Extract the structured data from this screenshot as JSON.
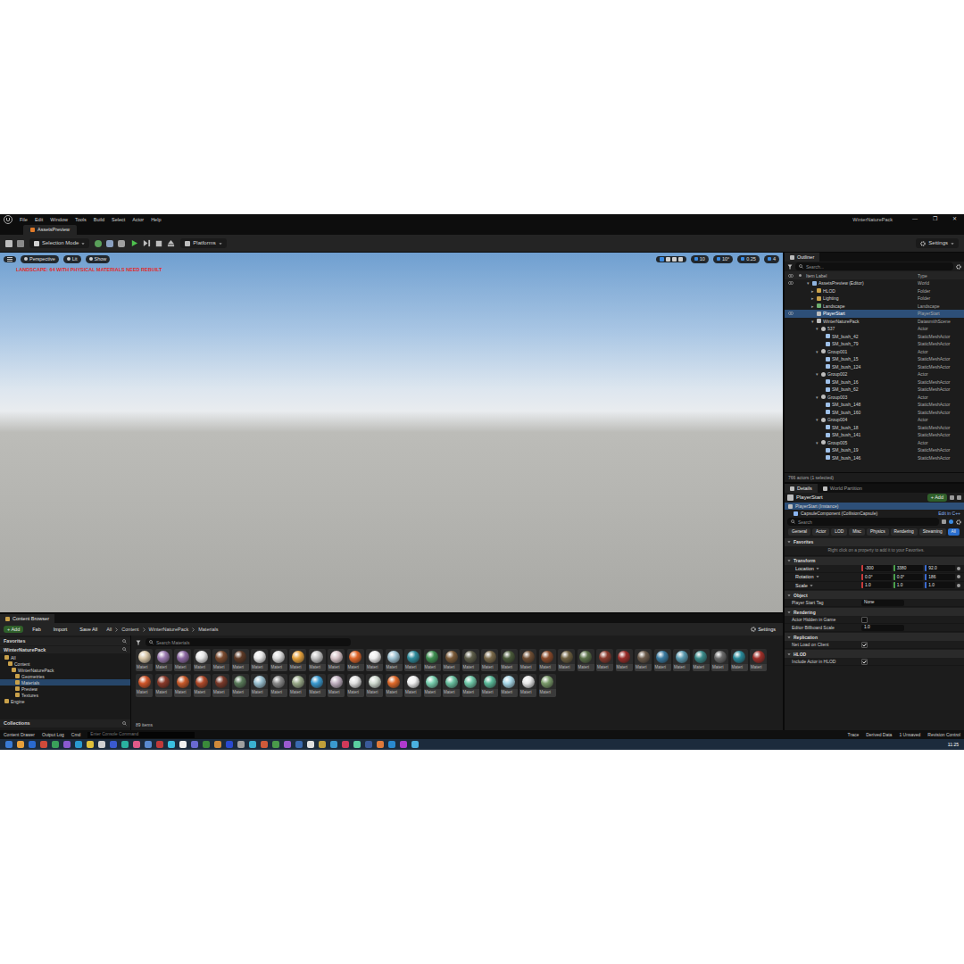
{
  "window": {
    "title": "WinterNaturePack",
    "controls": [
      "—",
      "❐",
      "✕"
    ]
  },
  "menu": [
    "File",
    "Edit",
    "Window",
    "Tools",
    "Build",
    "Select",
    "Actor",
    "Help"
  ],
  "document_tab": {
    "label": "AssetsPreview",
    "selected": true
  },
  "toolbar": {
    "mode": "Selection Mode",
    "platforms": "Platforms",
    "settings": "Settings"
  },
  "viewport": {
    "buttons": [
      "Perspective",
      "Lit",
      "Show"
    ],
    "snaps": [
      "10",
      "10°",
      "0.25",
      "4"
    ],
    "warning": "LANDSCAPE: 64 WITH PHYSICAL MATERIALS NEED REBUILT"
  },
  "outliner": {
    "tab": "Outliner",
    "search": "Search...",
    "columns": [
      "Item Label",
      "Type"
    ],
    "rows": [
      {
        "label": "AssetsPreview (Editor)",
        "type": "World",
        "depth": 0,
        "toggle": "▾",
        "kind": "world",
        "selected": false,
        "visible": true
      },
      {
        "label": "HLOD",
        "type": "Folder",
        "depth": 1,
        "toggle": "▸",
        "kind": "folder",
        "selected": false,
        "visible": false
      },
      {
        "label": "Lighting",
        "type": "Folder",
        "depth": 1,
        "toggle": "▸",
        "kind": "folder",
        "selected": false,
        "visible": false
      },
      {
        "label": "Landscape",
        "type": "Landscape",
        "depth": 1,
        "toggle": "▸",
        "kind": "landscape",
        "selected": false,
        "visible": false
      },
      {
        "label": "PlayerStart",
        "type": "PlayerStart",
        "depth": 1,
        "toggle": "",
        "kind": "actor",
        "selected": true,
        "visible": true
      },
      {
        "label": "WinterNaturePack",
        "type": "DatasmithScene",
        "depth": 1,
        "toggle": "▾",
        "kind": "actor",
        "selected": false,
        "visible": false
      },
      {
        "label": "537",
        "type": "Actor",
        "depth": 2,
        "toggle": "▾",
        "kind": "group",
        "selected": false,
        "visible": false
      },
      {
        "label": "SM_bush_42",
        "type": "StaticMeshActor",
        "depth": 3,
        "toggle": "",
        "kind": "mesh",
        "selected": false,
        "visible": false
      },
      {
        "label": "SM_bush_79",
        "type": "StaticMeshActor",
        "depth": 3,
        "toggle": "",
        "kind": "mesh",
        "selected": false,
        "visible": false
      },
      {
        "label": "Group001",
        "type": "Actor",
        "depth": 2,
        "toggle": "▾",
        "kind": "group",
        "selected": false,
        "visible": false
      },
      {
        "label": "SM_bush_15",
        "type": "StaticMeshActor",
        "depth": 3,
        "toggle": "",
        "kind": "mesh",
        "selected": false,
        "visible": false
      },
      {
        "label": "SM_bush_124",
        "type": "StaticMeshActor",
        "depth": 3,
        "toggle": "",
        "kind": "mesh",
        "selected": false,
        "visible": false
      },
      {
        "label": "Group002",
        "type": "Actor",
        "depth": 2,
        "toggle": "▾",
        "kind": "group",
        "selected": false,
        "visible": false
      },
      {
        "label": "SM_bush_16",
        "type": "StaticMeshActor",
        "depth": 3,
        "toggle": "",
        "kind": "mesh",
        "selected": false,
        "visible": false
      },
      {
        "label": "SM_bush_62",
        "type": "StaticMeshActor",
        "depth": 3,
        "toggle": "",
        "kind": "mesh",
        "selected": false,
        "visible": false
      },
      {
        "label": "Group003",
        "type": "Actor",
        "depth": 2,
        "toggle": "▾",
        "kind": "group",
        "selected": false,
        "visible": false
      },
      {
        "label": "SM_bush_148",
        "type": "StaticMeshActor",
        "depth": 3,
        "toggle": "",
        "kind": "mesh",
        "selected": false,
        "visible": false
      },
      {
        "label": "SM_bush_160",
        "type": "StaticMeshActor",
        "depth": 3,
        "toggle": "",
        "kind": "mesh",
        "selected": false,
        "visible": false
      },
      {
        "label": "Group004",
        "type": "Actor",
        "depth": 2,
        "toggle": "▾",
        "kind": "group",
        "selected": false,
        "visible": false
      },
      {
        "label": "SM_bush_18",
        "type": "StaticMeshActor",
        "depth": 3,
        "toggle": "",
        "kind": "mesh",
        "selected": false,
        "visible": false
      },
      {
        "label": "SM_bush_141",
        "type": "StaticMeshActor",
        "depth": 3,
        "toggle": "",
        "kind": "mesh",
        "selected": false,
        "visible": false
      },
      {
        "label": "Group005",
        "type": "Actor",
        "depth": 2,
        "toggle": "▾",
        "kind": "group",
        "selected": false,
        "visible": false
      },
      {
        "label": "SM_bush_19",
        "type": "StaticMeshActor",
        "depth": 3,
        "toggle": "",
        "kind": "mesh",
        "selected": false,
        "visible": false
      },
      {
        "label": "SM_bush_146",
        "type": "StaticMeshActor",
        "depth": 3,
        "toggle": "",
        "kind": "mesh",
        "selected": false,
        "visible": false
      }
    ],
    "footer": "766 actors (1 selected)"
  },
  "details": {
    "tabs": [
      {
        "label": "Details",
        "selected": true
      },
      {
        "label": "World Partition",
        "selected": false
      }
    ],
    "actor": "PlayerStart",
    "add": "+ Add",
    "components": [
      {
        "label": "PlayerStart (Instance)",
        "selected": true
      },
      {
        "label": "CapsuleComponent (CollisionCapsule)",
        "selected": false
      }
    ],
    "edit_link": "Edit in C++",
    "search": "Search",
    "filters": [
      {
        "label": "General",
        "selected": false
      },
      {
        "label": "Actor",
        "selected": false
      },
      {
        "label": "LOD",
        "selected": false
      },
      {
        "label": "Misc",
        "selected": false
      },
      {
        "label": "Physics",
        "selected": false
      },
      {
        "label": "Rendering",
        "selected": false
      },
      {
        "label": "Streaming",
        "selected": false
      },
      {
        "label": "All",
        "selected": true
      }
    ],
    "sections": [
      {
        "title": "Favorites",
        "rows": [
          {
            "kind": "hint",
            "label": "Right click on a property to add it to your Favorites.",
            "values": [],
            "value": "",
            "checked": false
          }
        ]
      },
      {
        "title": "Transform",
        "rows": [
          {
            "kind": "vector",
            "label": "Location",
            "values": [
              "-300",
              "3380",
              "92.0"
            ],
            "value": "",
            "checked": false
          },
          {
            "kind": "vector",
            "label": "Rotation",
            "values": [
              "0.0°",
              "0.0°",
              "186"
            ],
            "value": "",
            "checked": false
          },
          {
            "kind": "vector",
            "label": "Scale",
            "values": [
              "1.0",
              "1.0",
              "1.0"
            ],
            "value": "",
            "checked": false
          }
        ]
      },
      {
        "title": "Object",
        "rows": [
          {
            "kind": "text",
            "label": "Player Start Tag",
            "values": [],
            "value": "None",
            "checked": false
          }
        ]
      },
      {
        "title": "Rendering",
        "rows": [
          {
            "kind": "check",
            "label": "Actor Hidden in Game",
            "values": [],
            "value": "",
            "checked": false
          },
          {
            "kind": "text",
            "label": "Editor Billboard Scale",
            "values": [],
            "value": "1.0",
            "checked": false
          }
        ]
      },
      {
        "title": "Replication",
        "rows": [
          {
            "kind": "check",
            "label": "Net Load on Client",
            "values": [],
            "value": "",
            "checked": true
          }
        ]
      },
      {
        "title": "HLOD",
        "rows": [
          {
            "kind": "check",
            "label": "Include Actor in HLOD",
            "values": [],
            "value": "",
            "checked": true
          }
        ]
      }
    ]
  },
  "content_browser": {
    "tab": "Content Browser",
    "actions": [
      "+ Add",
      "Fab",
      "Import",
      "Save All"
    ],
    "path": [
      "All",
      "Content",
      "WinterNaturePack",
      "Materials"
    ],
    "settings": "Settings",
    "favorites": "Favorites",
    "root": "WinterNaturePack",
    "tree": [
      {
        "label": "All",
        "depth": 0,
        "selected": false
      },
      {
        "label": "Content",
        "depth": 1,
        "selected": false
      },
      {
        "label": "WinterNaturePack",
        "depth": 2,
        "selected": false
      },
      {
        "label": "Geometries",
        "depth": 3,
        "selected": false
      },
      {
        "label": "Materials",
        "depth": 3,
        "selected": true
      },
      {
        "label": "Preview",
        "depth": 3,
        "selected": false
      },
      {
        "label": "Textures",
        "depth": 3,
        "selected": false
      },
      {
        "label": "Engine",
        "depth": 0,
        "selected": false
      }
    ],
    "collections": "Collections",
    "search": "Search Materials",
    "assets": [
      {
        "label": "Materi",
        "color": "#d9c7a8"
      },
      {
        "label": "Materi",
        "color": "#9b7bb0"
      },
      {
        "label": "Materi",
        "color": "#8d6aa3"
      },
      {
        "label": "Materi",
        "color": "#e6e6e6"
      },
      {
        "label": "Materi",
        "color": "#7a4a2e"
      },
      {
        "label": "Materi",
        "color": "#5e3a26"
      },
      {
        "label": "Materi",
        "color": "#e9e9e9"
      },
      {
        "label": "Materi",
        "color": "#dcdcdc"
      },
      {
        "label": "Materi",
        "color": "#e5a23e"
      },
      {
        "label": "Materi",
        "color": "#c4c4c4"
      },
      {
        "label": "Materi",
        "color": "#d8c4c8"
      },
      {
        "label": "Materi",
        "color": "#e0662a"
      },
      {
        "label": "Materi",
        "color": "#eeeeee"
      },
      {
        "label": "Materi",
        "color": "#9fc3d3"
      },
      {
        "label": "Materi",
        "color": "#2f8c9c"
      },
      {
        "label": "Materi",
        "color": "#3f8f52"
      },
      {
        "label": "Materi",
        "color": "#7a5a38"
      },
      {
        "label": "Materi",
        "color": "#5e5e4a"
      },
      {
        "label": "Materi",
        "color": "#7a6a4a"
      },
      {
        "label": "Materi",
        "color": "#4a5a3a"
      },
      {
        "label": "Materi",
        "color": "#6e4e34"
      },
      {
        "label": "Materi",
        "color": "#8a4a2a"
      },
      {
        "label": "Materi",
        "color": "#6e6040"
      },
      {
        "label": "Materi",
        "color": "#5a7048"
      },
      {
        "label": "Materi",
        "color": "#8a3a2e"
      },
      {
        "label": "Materi",
        "color": "#9a2e2a"
      },
      {
        "label": "Materi",
        "color": "#6a5a4a"
      },
      {
        "label": "Materi",
        "color": "#3a7aa0"
      },
      {
        "label": "Materi",
        "color": "#5a9ab0"
      },
      {
        "label": "Materi",
        "color": "#3a8a8a"
      },
      {
        "label": "Materi",
        "color": "#6a6a6a"
      },
      {
        "label": "Materi",
        "color": "#2a8a9a"
      },
      {
        "label": "Materi",
        "color": "#a0302a"
      },
      {
        "label": "Materi",
        "color": "#d0562a"
      },
      {
        "label": "Materi",
        "color": "#8a3a2a"
      },
      {
        "label": "Materi",
        "color": "#c85a2a"
      },
      {
        "label": "Materi",
        "color": "#b04a2a"
      },
      {
        "label": "Materi",
        "color": "#7a3a2a"
      },
      {
        "label": "Materi",
        "color": "#5a7a5a"
      },
      {
        "label": "Materi",
        "color": "#9ac0d0"
      },
      {
        "label": "Materi",
        "color": "#8a8a8a"
      },
      {
        "label": "Materi",
        "color": "#9aaa8a"
      },
      {
        "label": "Materi",
        "color": "#3a9ad0"
      },
      {
        "label": "Materi",
        "color": "#c0b0c0"
      },
      {
        "label": "Materi",
        "color": "#e0e0e0"
      },
      {
        "label": "Materi",
        "color": "#d0dad0"
      },
      {
        "label": "Materi",
        "color": "#e06a2a"
      },
      {
        "label": "Materi",
        "color": "#f0f0f0"
      },
      {
        "label": "Materi",
        "color": "#7ad0b0"
      },
      {
        "label": "Materi",
        "color": "#6ac0a0"
      },
      {
        "label": "Materi",
        "color": "#70c8a8"
      },
      {
        "label": "Materi",
        "color": "#5ab898"
      },
      {
        "label": "Materi",
        "color": "#a8d8e8"
      },
      {
        "label": "Materi",
        "color": "#e8e8e8"
      },
      {
        "label": "Materi",
        "color": "#7a9a6a"
      }
    ],
    "count": "89 items"
  },
  "status_bar": {
    "left": [
      "Content Drawer",
      "Output Log",
      "Cmd"
    ],
    "console": "Enter Console Command",
    "right": [
      "Trace",
      "Derived Data",
      "1 Unsaved",
      "Revision Control"
    ]
  },
  "taskbar": {
    "time": "11:25",
    "icons": [
      {
        "color": "#3a7bd5"
      },
      {
        "color": "#e8a03a"
      },
      {
        "color": "#2a6ad0"
      },
      {
        "color": "#d04a3a"
      },
      {
        "color": "#3aa05a"
      },
      {
        "color": "#8a5ad0"
      },
      {
        "color": "#2a9ad0"
      },
      {
        "color": "#e0c03a"
      },
      {
        "color": "#d0d0d0"
      },
      {
        "color": "#3a5ad0"
      },
      {
        "color": "#2ab0a0"
      },
      {
        "color": "#e05a8a"
      },
      {
        "color": "#5a8ad0"
      },
      {
        "color": "#c03a3a"
      },
      {
        "color": "#3ac0e0"
      },
      {
        "color": "#f0f0f0"
      },
      {
        "color": "#6a6ad0"
      },
      {
        "color": "#3a8a3a"
      },
      {
        "color": "#d08a3a"
      },
      {
        "color": "#2a4ad0"
      },
      {
        "color": "#a0a0a0"
      },
      {
        "color": "#3ab0d0"
      },
      {
        "color": "#d05a3a"
      },
      {
        "color": "#4a9a4a"
      },
      {
        "color": "#9a5ad0"
      },
      {
        "color": "#3a6ab0"
      },
      {
        "color": "#e0e0e0"
      },
      {
        "color": "#c0a03a"
      },
      {
        "color": "#3a9ad0"
      },
      {
        "color": "#d03a5a"
      },
      {
        "color": "#5ad0a0"
      },
      {
        "color": "#3a5a9a"
      },
      {
        "color": "#e07a3a"
      },
      {
        "color": "#2a8ad0"
      },
      {
        "color": "#b03ad0"
      },
      {
        "color": "#4ab0e0"
      }
    ]
  }
}
